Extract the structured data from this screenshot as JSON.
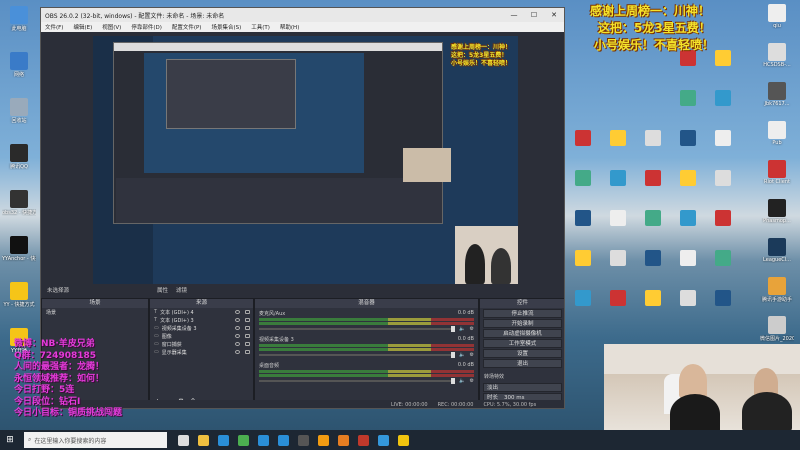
{
  "desktop_left": [
    {
      "label": "此电脑",
      "color": "#4a90d9"
    },
    {
      "label": "网络",
      "color": "#3a7bc8"
    },
    {
      "label": "回收站",
      "color": "#9ab"
    },
    {
      "label": "腾讯QQ",
      "color": "#2a2a2a"
    },
    {
      "label": "obs32 - 快捷方式",
      "color": "#333"
    },
    {
      "label": "YYAnchor - 快捷方式",
      "color": "#111"
    },
    {
      "label": "YY - 快捷方式",
      "color": "#f5c518"
    },
    {
      "label": "YY开播",
      "color": "#f5c518"
    }
  ],
  "desktop_right": [
    {
      "label": "qiu",
      "color": "#eee"
    },
    {
      "label": "HCSDSB-...",
      "color": "#ddd"
    },
    {
      "label": "Jbk7617...",
      "color": "#555"
    },
    {
      "label": "Pub",
      "color": "#eee"
    },
    {
      "label": "Riot Client",
      "color": "#c33"
    },
    {
      "label": "Phasmop...",
      "color": "#222"
    },
    {
      "label": "LeagueCl...",
      "color": "#1b3a5a"
    },
    {
      "label": "腾讯手游助手",
      "color": "#e8a33a"
    },
    {
      "label": "微信图片_2020101...",
      "color": "#ccc"
    }
  ],
  "obs": {
    "title": "OBS 26.0.2 (32-bit, windows) - 配置文件: 未命名 - 场景: 未命名",
    "menu": [
      "文件(F)",
      "编辑(E)",
      "视图(V)",
      "停靠部件(D)",
      "配置文件(P)",
      "场景集合(S)",
      "工具(T)",
      "帮助(H)"
    ],
    "no_source": "未选择源",
    "ctrl_props": "属性",
    "ctrl_filters": "滤镜",
    "docks": {
      "scenes": "场景",
      "sources": "来源",
      "mixer": "混音器",
      "controls": "控件"
    },
    "scene_item": "场景",
    "sources": [
      "文本 (GDI+) 4",
      "文本 (GDI+) 3",
      "视频采集设备 3",
      "图像",
      "窗口捕获",
      "显示器采集"
    ],
    "mixer": [
      {
        "name": "麦克风/Aux",
        "db": "0.0 dB"
      },
      {
        "name": "视频采集设备 3",
        "db": "0.0 dB"
      },
      {
        "name": "桌面音频",
        "db": "0.0 dB"
      }
    ],
    "controls": [
      "停止推流",
      "开始录制",
      "启动虚拟摄像机",
      "工作室模式",
      "设置",
      "退出"
    ],
    "transition_label": "转场特效",
    "transition_value": "淡出",
    "duration_label": "时长",
    "duration_value": "300 ms",
    "status": {
      "live": "LIVE: 00:00:00",
      "rec": "REC: 00:00:00",
      "cpu": "CPU: 5.7%, 30.00 fps"
    }
  },
  "overlay_top": [
    "感谢上周榜一：川神！",
    "这把：5龙3星五费！",
    "小号娱乐！不喜轻喷！"
  ],
  "overlay_left": [
    "微博：NB·羊皮兄弟",
    "Q群：724908185",
    "人间的最强者：龙腾！",
    "永恒领域推荐：如何！",
    "今日打野：5连",
    "今日段位：钻石I",
    "今日小目标：铜质挑战闯题"
  ],
  "taskbar": {
    "search_placeholder": "在这里输入你要搜索的内容",
    "pinned": [
      "task-view",
      "explorer",
      "edge",
      "chrome",
      "store",
      "mail",
      "obs",
      "game1",
      "game2",
      "game3",
      "game4",
      "game5"
    ]
  },
  "colors": {
    "obs_bg": "#2b2e38",
    "overlay_yellow": "#f4e32a",
    "overlay_magenta": "#e43ad9",
    "taskbar": "#1d2733"
  }
}
